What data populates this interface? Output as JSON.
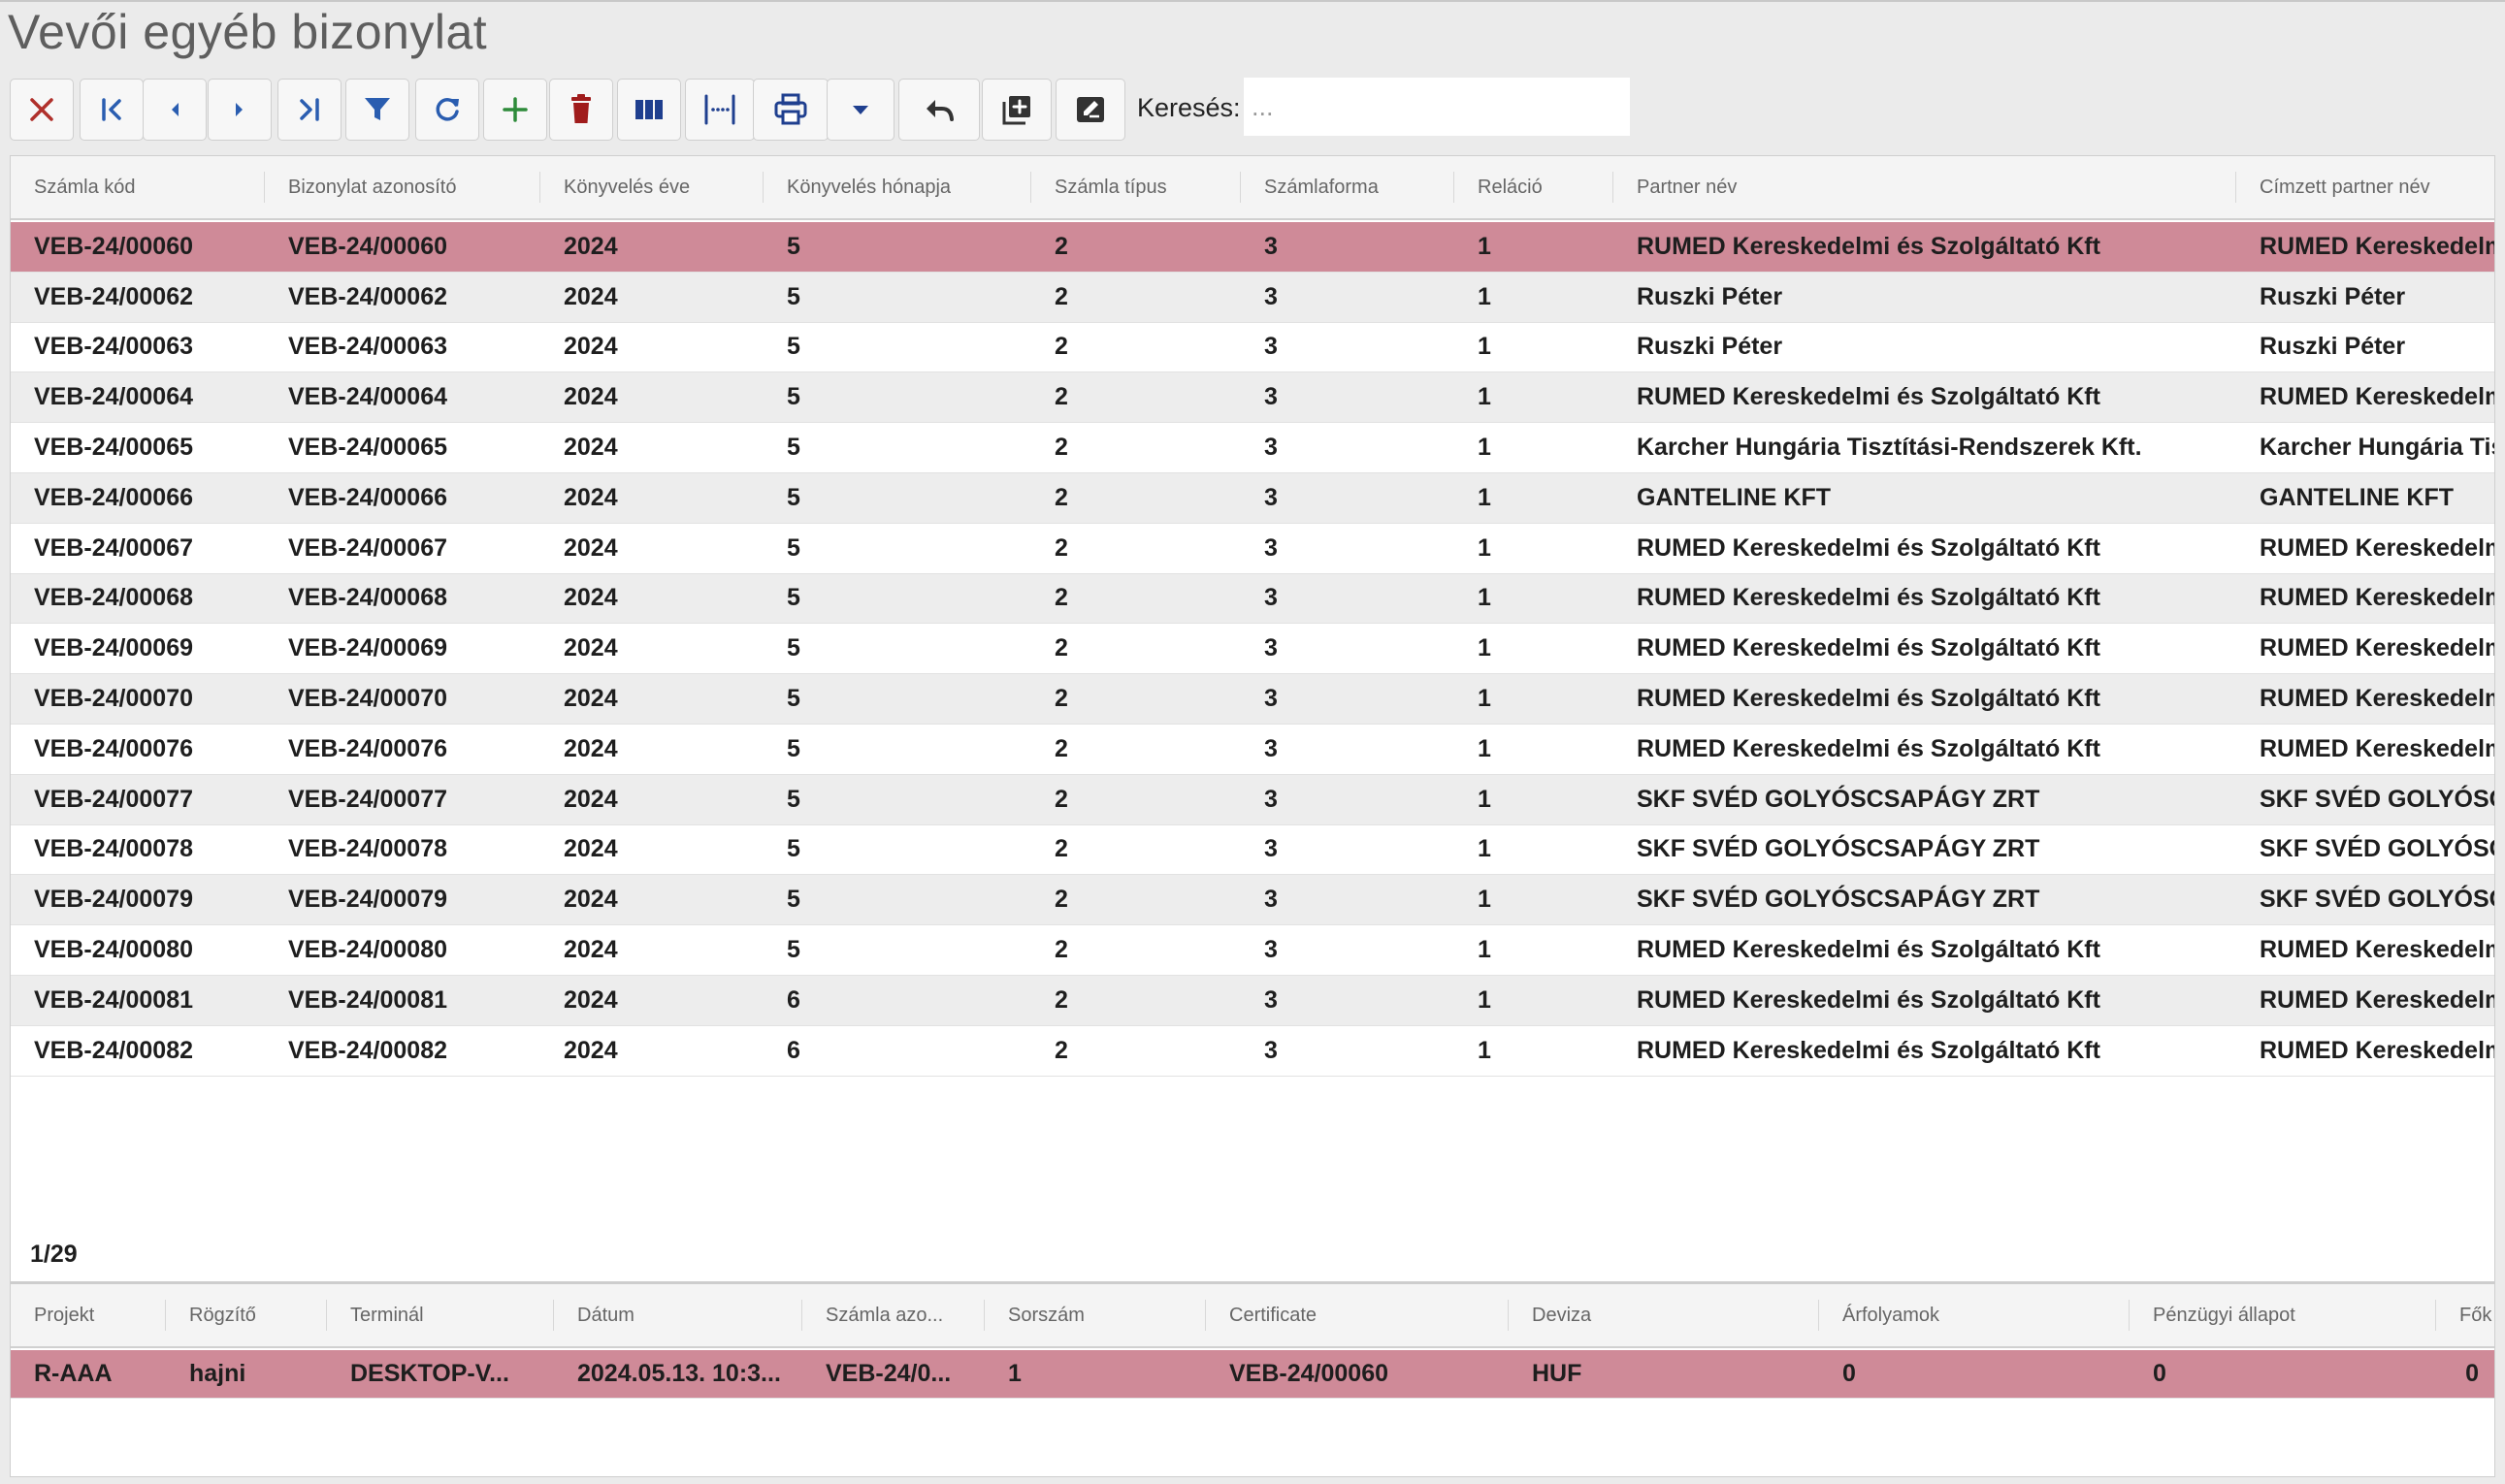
{
  "title": "Vevői egyéb bizonylat",
  "toolbar": {
    "buttons": [
      {
        "name": "close-button",
        "icon": "close-icon",
        "color": "#b0302b"
      },
      {
        "name": "first-record-button",
        "icon": "first-icon",
        "color": "#2a5db0"
      },
      {
        "name": "prev-record-button",
        "icon": "prev-icon",
        "color": "#2a5db0"
      },
      {
        "name": "next-record-button",
        "icon": "next-icon",
        "color": "#2a5db0"
      },
      {
        "name": "last-record-button",
        "icon": "last-icon",
        "color": "#2a5db0"
      },
      {
        "name": "filter-button",
        "icon": "filter-icon",
        "color": "#2a5db0"
      },
      {
        "name": "refresh-button",
        "icon": "refresh-icon",
        "color": "#2a5db0"
      },
      {
        "name": "add-button",
        "icon": "plus-icon",
        "color": "#2e8b3a"
      },
      {
        "name": "delete-button",
        "icon": "trash-icon",
        "color": "#a01c1c"
      },
      {
        "name": "columns-button",
        "icon": "columns-icon",
        "color": "#1f3f8f"
      },
      {
        "name": "column-width-button",
        "icon": "column-width-icon",
        "color": "#1f3f8f"
      },
      {
        "name": "print-button",
        "icon": "print-icon",
        "color": "#1f3f8f"
      },
      {
        "name": "print-dropdown-button",
        "icon": "caret-down-icon",
        "color": "#1f3f8f"
      },
      {
        "name": "undo-button",
        "icon": "undo-icon",
        "color": "#333333"
      },
      {
        "name": "copy-button",
        "icon": "copy-icon",
        "color": "#333333"
      },
      {
        "name": "edit-note-button",
        "icon": "edit-note-icon",
        "color": "#333333"
      }
    ]
  },
  "search": {
    "label": "Keresés:",
    "placeholder": "..."
  },
  "main_table": {
    "columns": [
      "Számla kód",
      "Bizonylat azonosító",
      "Könyvelés éve",
      "Könyvelés hónapja",
      "Számla típus",
      "Számlaforma",
      "Reláció",
      "Partner név",
      "Címzett partner név"
    ],
    "rows": [
      [
        "VEB-24/00060",
        "VEB-24/00060",
        "2024",
        "5",
        "2",
        "3",
        "1",
        "RUMED Kereskedelmi és Szolgáltató Kft",
        "RUMED Kereskedelm"
      ],
      [
        "VEB-24/00062",
        "VEB-24/00062",
        "2024",
        "5",
        "2",
        "3",
        "1",
        "Ruszki Péter",
        "Ruszki Péter"
      ],
      [
        "VEB-24/00063",
        "VEB-24/00063",
        "2024",
        "5",
        "2",
        "3",
        "1",
        "Ruszki Péter",
        "Ruszki Péter"
      ],
      [
        "VEB-24/00064",
        "VEB-24/00064",
        "2024",
        "5",
        "2",
        "3",
        "1",
        "RUMED Kereskedelmi és Szolgáltató Kft",
        "RUMED Kereskedelm"
      ],
      [
        "VEB-24/00065",
        "VEB-24/00065",
        "2024",
        "5",
        "2",
        "3",
        "1",
        "Karcher Hungária Tisztítási-Rendszerek Kft.",
        "Karcher Hungária Tis"
      ],
      [
        "VEB-24/00066",
        "VEB-24/00066",
        "2024",
        "5",
        "2",
        "3",
        "1",
        "GANTELINE KFT",
        "GANTELINE KFT"
      ],
      [
        "VEB-24/00067",
        "VEB-24/00067",
        "2024",
        "5",
        "2",
        "3",
        "1",
        "RUMED Kereskedelmi és Szolgáltató Kft",
        "RUMED Kereskedelm"
      ],
      [
        "VEB-24/00068",
        "VEB-24/00068",
        "2024",
        "5",
        "2",
        "3",
        "1",
        "RUMED Kereskedelmi és Szolgáltató Kft",
        "RUMED Kereskedelm"
      ],
      [
        "VEB-24/00069",
        "VEB-24/00069",
        "2024",
        "5",
        "2",
        "3",
        "1",
        "RUMED Kereskedelmi és Szolgáltató Kft",
        "RUMED Kereskedelm"
      ],
      [
        "VEB-24/00070",
        "VEB-24/00070",
        "2024",
        "5",
        "2",
        "3",
        "1",
        "RUMED Kereskedelmi és Szolgáltató Kft",
        "RUMED Kereskedelm"
      ],
      [
        "VEB-24/00076",
        "VEB-24/00076",
        "2024",
        "5",
        "2",
        "3",
        "1",
        "RUMED Kereskedelmi és Szolgáltató Kft",
        "RUMED Kereskedelm"
      ],
      [
        "VEB-24/00077",
        "VEB-24/00077",
        "2024",
        "5",
        "2",
        "3",
        "1",
        "SKF SVÉD GOLYÓSCSAPÁGY ZRT",
        "SKF SVÉD GOLYÓSCS"
      ],
      [
        "VEB-24/00078",
        "VEB-24/00078",
        "2024",
        "5",
        "2",
        "3",
        "1",
        "SKF SVÉD GOLYÓSCSAPÁGY ZRT",
        "SKF SVÉD GOLYÓSCS"
      ],
      [
        "VEB-24/00079",
        "VEB-24/00079",
        "2024",
        "5",
        "2",
        "3",
        "1",
        "SKF SVÉD GOLYÓSCSAPÁGY ZRT",
        "SKF SVÉD GOLYÓSCS"
      ],
      [
        "VEB-24/00080",
        "VEB-24/00080",
        "2024",
        "5",
        "2",
        "3",
        "1",
        "RUMED Kereskedelmi és Szolgáltató Kft",
        "RUMED Kereskedelm"
      ],
      [
        "VEB-24/00081",
        "VEB-24/00081",
        "2024",
        "6",
        "2",
        "3",
        "1",
        "RUMED Kereskedelmi és Szolgáltató Kft",
        "RUMED Kereskedelm"
      ],
      [
        "VEB-24/00082",
        "VEB-24/00082",
        "2024",
        "6",
        "2",
        "3",
        "1",
        "RUMED Kereskedelmi és Szolgáltató Kft",
        "RUMED Kereskedelm"
      ]
    ],
    "selected_row": 0,
    "pager": "1/29"
  },
  "detail_table": {
    "columns": [
      "Projekt",
      "Rögzítő",
      "Terminál",
      "Dátum",
      "Számla azo...",
      "Sorszám",
      "Certificate",
      "Deviza",
      "Árfolyamok",
      "Pénzügyi állapot",
      "Fők"
    ],
    "rows": [
      [
        "R-AAA",
        "hajni",
        "DESKTOP-V...",
        "2024.05.13. 10:3...",
        "VEB-24/0...",
        "1",
        "VEB-24/00060",
        "HUF",
        "0",
        "0",
        "0"
      ]
    ],
    "selected_row": 0
  },
  "colors": {
    "selected_row": "#cf8a98",
    "zebra_row": "#ededed",
    "header_bg": "#f4f4f4",
    "page_bg": "#ebebeb"
  }
}
